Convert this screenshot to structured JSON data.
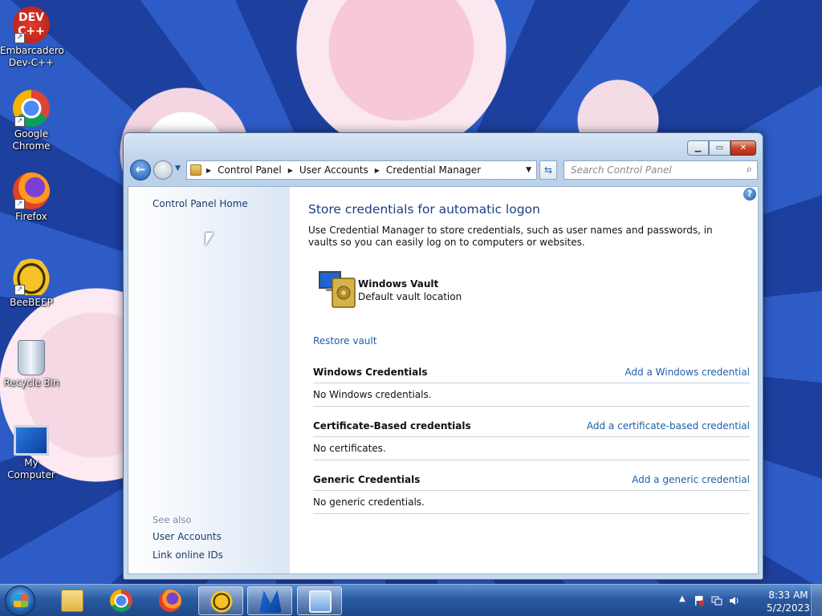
{
  "desktop": {
    "icons": [
      {
        "label": "Embarcadero Dev-C++",
        "icon": "devcpp-icon"
      },
      {
        "label": "Google Chrome",
        "icon": "chrome-icon"
      },
      {
        "label": "Firefox",
        "icon": "firefox-icon"
      },
      {
        "label": "BeeBEEP",
        "icon": "beebeep-icon"
      },
      {
        "label": "Recycle Bin",
        "icon": "recycle-bin-icon"
      },
      {
        "label": "My Computer",
        "icon": "computer-icon"
      }
    ],
    "devcpp_badge": "DEV\nC++"
  },
  "window": {
    "breadcrumb": [
      "Control Panel",
      "User Accounts",
      "Credential Manager"
    ],
    "search_placeholder": "Search Control Panel",
    "left_pane": {
      "home_link": "Control Panel Home",
      "see_also_label": "See also",
      "see_also_links": [
        "User Accounts",
        "Link online IDs"
      ]
    },
    "main": {
      "title": "Store credentials for automatic logon",
      "description": "Use Credential Manager to store credentials, such as user names and passwords, in vaults so you can easily log on to computers or websites.",
      "vault_name": "Windows Vault",
      "vault_location": "Default vault location",
      "restore_link": "Restore vault",
      "sections": [
        {
          "heading": "Windows Credentials",
          "action": "Add a Windows credential",
          "empty_text": "No Windows credentials."
        },
        {
          "heading": "Certificate-Based credentials",
          "action": "Add a certificate-based credential",
          "empty_text": "No certificates."
        },
        {
          "heading": "Generic Credentials",
          "action": "Add a generic credential",
          "empty_text": "No generic credentials."
        }
      ]
    }
  },
  "taskbar": {
    "pinned": [
      "explorer-icon",
      "chrome-icon",
      "firefox-icon",
      "beebeep-icon",
      "malwarebytes-icon",
      "control-panel-icon"
    ],
    "clock_time": "8:33 AM",
    "clock_date": "5/2/2023"
  },
  "colors": {
    "link": "#1e5fa8",
    "title": "#1b3f83",
    "taskbar": "#2a5aa2"
  }
}
